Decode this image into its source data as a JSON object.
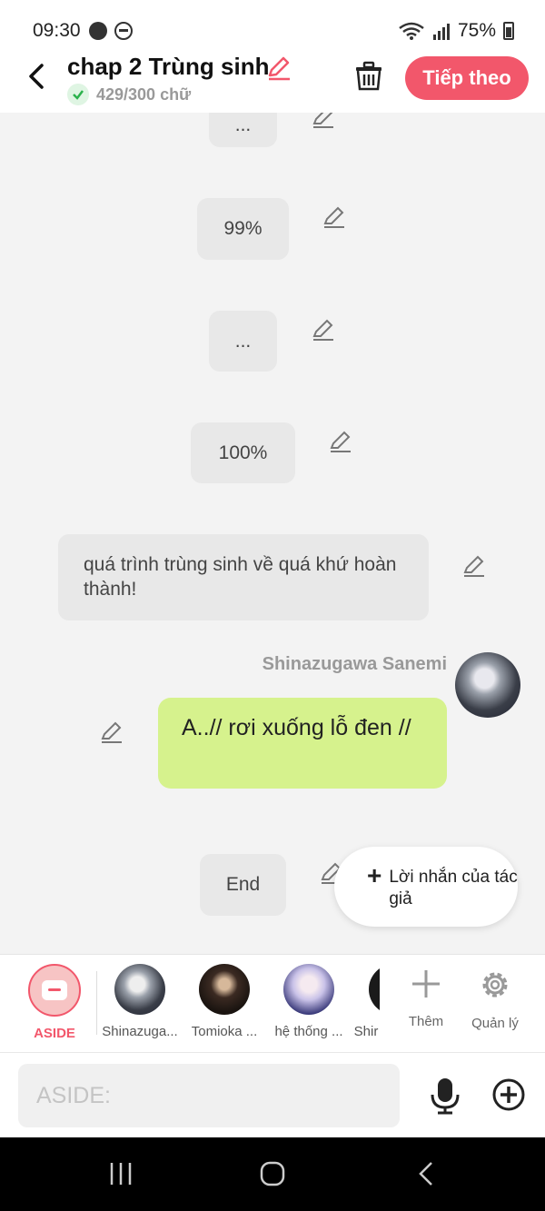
{
  "status": {
    "time": "09:30",
    "battery": "75%"
  },
  "header": {
    "title": "chap 2 Trùng sinh",
    "word_count": "429/300 chữ",
    "next_label": "Tiếp theo"
  },
  "messages": {
    "m1": "...",
    "m2": "99%",
    "m3": "...",
    "m4": "100%",
    "m5": "quá trình trùng sinh về quá khứ hoàn thành!",
    "character_name": "Shinazugawa Sanemi",
    "m6": "A..// rơi xuống lỗ đen //",
    "m7": "End"
  },
  "author_note": {
    "label": "Lời nhắn của tác giả"
  },
  "characters": {
    "aside": "ASIDE",
    "c1": "Shinazuga...",
    "c2": "Tomioka ...",
    "c3": "hệ thống ...",
    "c4": "Shir",
    "add": "Thêm",
    "manage": "Quản lý"
  },
  "input": {
    "placeholder": "ASIDE:"
  },
  "colors": {
    "accent": "#f2576b",
    "player_bubble": "#d6f28d",
    "narration_bubble": "#e8e8e8"
  }
}
